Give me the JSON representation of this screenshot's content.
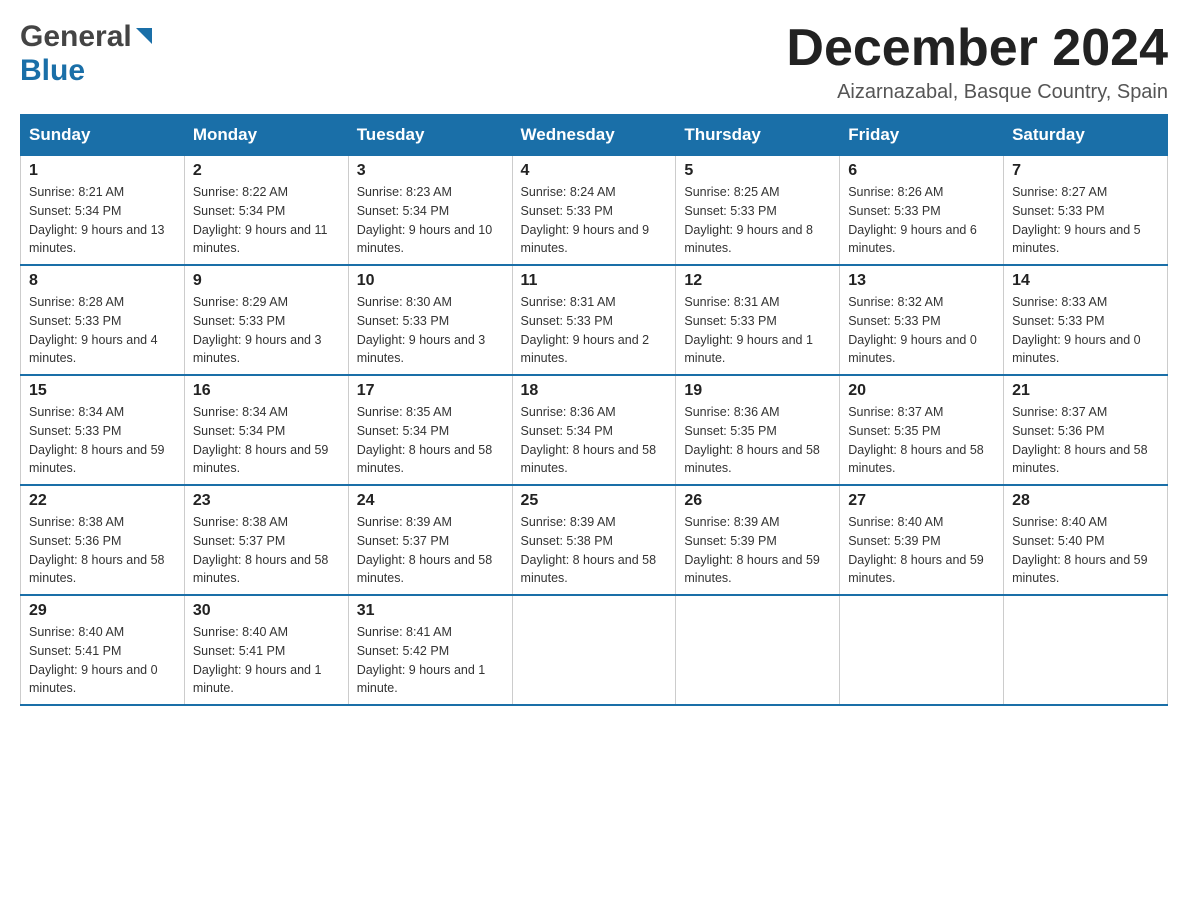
{
  "header": {
    "logo_general": "General",
    "logo_blue": "Blue",
    "month_title": "December 2024",
    "location": "Aizarnazabal, Basque Country, Spain"
  },
  "weekdays": [
    "Sunday",
    "Monday",
    "Tuesday",
    "Wednesday",
    "Thursday",
    "Friday",
    "Saturday"
  ],
  "weeks": [
    [
      {
        "day": "1",
        "sunrise": "Sunrise: 8:21 AM",
        "sunset": "Sunset: 5:34 PM",
        "daylight": "Daylight: 9 hours and 13 minutes."
      },
      {
        "day": "2",
        "sunrise": "Sunrise: 8:22 AM",
        "sunset": "Sunset: 5:34 PM",
        "daylight": "Daylight: 9 hours and 11 minutes."
      },
      {
        "day": "3",
        "sunrise": "Sunrise: 8:23 AM",
        "sunset": "Sunset: 5:34 PM",
        "daylight": "Daylight: 9 hours and 10 minutes."
      },
      {
        "day": "4",
        "sunrise": "Sunrise: 8:24 AM",
        "sunset": "Sunset: 5:33 PM",
        "daylight": "Daylight: 9 hours and 9 minutes."
      },
      {
        "day": "5",
        "sunrise": "Sunrise: 8:25 AM",
        "sunset": "Sunset: 5:33 PM",
        "daylight": "Daylight: 9 hours and 8 minutes."
      },
      {
        "day": "6",
        "sunrise": "Sunrise: 8:26 AM",
        "sunset": "Sunset: 5:33 PM",
        "daylight": "Daylight: 9 hours and 6 minutes."
      },
      {
        "day": "7",
        "sunrise": "Sunrise: 8:27 AM",
        "sunset": "Sunset: 5:33 PM",
        "daylight": "Daylight: 9 hours and 5 minutes."
      }
    ],
    [
      {
        "day": "8",
        "sunrise": "Sunrise: 8:28 AM",
        "sunset": "Sunset: 5:33 PM",
        "daylight": "Daylight: 9 hours and 4 minutes."
      },
      {
        "day": "9",
        "sunrise": "Sunrise: 8:29 AM",
        "sunset": "Sunset: 5:33 PM",
        "daylight": "Daylight: 9 hours and 3 minutes."
      },
      {
        "day": "10",
        "sunrise": "Sunrise: 8:30 AM",
        "sunset": "Sunset: 5:33 PM",
        "daylight": "Daylight: 9 hours and 3 minutes."
      },
      {
        "day": "11",
        "sunrise": "Sunrise: 8:31 AM",
        "sunset": "Sunset: 5:33 PM",
        "daylight": "Daylight: 9 hours and 2 minutes."
      },
      {
        "day": "12",
        "sunrise": "Sunrise: 8:31 AM",
        "sunset": "Sunset: 5:33 PM",
        "daylight": "Daylight: 9 hours and 1 minute."
      },
      {
        "day": "13",
        "sunrise": "Sunrise: 8:32 AM",
        "sunset": "Sunset: 5:33 PM",
        "daylight": "Daylight: 9 hours and 0 minutes."
      },
      {
        "day": "14",
        "sunrise": "Sunrise: 8:33 AM",
        "sunset": "Sunset: 5:33 PM",
        "daylight": "Daylight: 9 hours and 0 minutes."
      }
    ],
    [
      {
        "day": "15",
        "sunrise": "Sunrise: 8:34 AM",
        "sunset": "Sunset: 5:33 PM",
        "daylight": "Daylight: 8 hours and 59 minutes."
      },
      {
        "day": "16",
        "sunrise": "Sunrise: 8:34 AM",
        "sunset": "Sunset: 5:34 PM",
        "daylight": "Daylight: 8 hours and 59 minutes."
      },
      {
        "day": "17",
        "sunrise": "Sunrise: 8:35 AM",
        "sunset": "Sunset: 5:34 PM",
        "daylight": "Daylight: 8 hours and 58 minutes."
      },
      {
        "day": "18",
        "sunrise": "Sunrise: 8:36 AM",
        "sunset": "Sunset: 5:34 PM",
        "daylight": "Daylight: 8 hours and 58 minutes."
      },
      {
        "day": "19",
        "sunrise": "Sunrise: 8:36 AM",
        "sunset": "Sunset: 5:35 PM",
        "daylight": "Daylight: 8 hours and 58 minutes."
      },
      {
        "day": "20",
        "sunrise": "Sunrise: 8:37 AM",
        "sunset": "Sunset: 5:35 PM",
        "daylight": "Daylight: 8 hours and 58 minutes."
      },
      {
        "day": "21",
        "sunrise": "Sunrise: 8:37 AM",
        "sunset": "Sunset: 5:36 PM",
        "daylight": "Daylight: 8 hours and 58 minutes."
      }
    ],
    [
      {
        "day": "22",
        "sunrise": "Sunrise: 8:38 AM",
        "sunset": "Sunset: 5:36 PM",
        "daylight": "Daylight: 8 hours and 58 minutes."
      },
      {
        "day": "23",
        "sunrise": "Sunrise: 8:38 AM",
        "sunset": "Sunset: 5:37 PM",
        "daylight": "Daylight: 8 hours and 58 minutes."
      },
      {
        "day": "24",
        "sunrise": "Sunrise: 8:39 AM",
        "sunset": "Sunset: 5:37 PM",
        "daylight": "Daylight: 8 hours and 58 minutes."
      },
      {
        "day": "25",
        "sunrise": "Sunrise: 8:39 AM",
        "sunset": "Sunset: 5:38 PM",
        "daylight": "Daylight: 8 hours and 58 minutes."
      },
      {
        "day": "26",
        "sunrise": "Sunrise: 8:39 AM",
        "sunset": "Sunset: 5:39 PM",
        "daylight": "Daylight: 8 hours and 59 minutes."
      },
      {
        "day": "27",
        "sunrise": "Sunrise: 8:40 AM",
        "sunset": "Sunset: 5:39 PM",
        "daylight": "Daylight: 8 hours and 59 minutes."
      },
      {
        "day": "28",
        "sunrise": "Sunrise: 8:40 AM",
        "sunset": "Sunset: 5:40 PM",
        "daylight": "Daylight: 8 hours and 59 minutes."
      }
    ],
    [
      {
        "day": "29",
        "sunrise": "Sunrise: 8:40 AM",
        "sunset": "Sunset: 5:41 PM",
        "daylight": "Daylight: 9 hours and 0 minutes."
      },
      {
        "day": "30",
        "sunrise": "Sunrise: 8:40 AM",
        "sunset": "Sunset: 5:41 PM",
        "daylight": "Daylight: 9 hours and 1 minute."
      },
      {
        "day": "31",
        "sunrise": "Sunrise: 8:41 AM",
        "sunset": "Sunset: 5:42 PM",
        "daylight": "Daylight: 9 hours and 1 minute."
      },
      null,
      null,
      null,
      null
    ]
  ]
}
